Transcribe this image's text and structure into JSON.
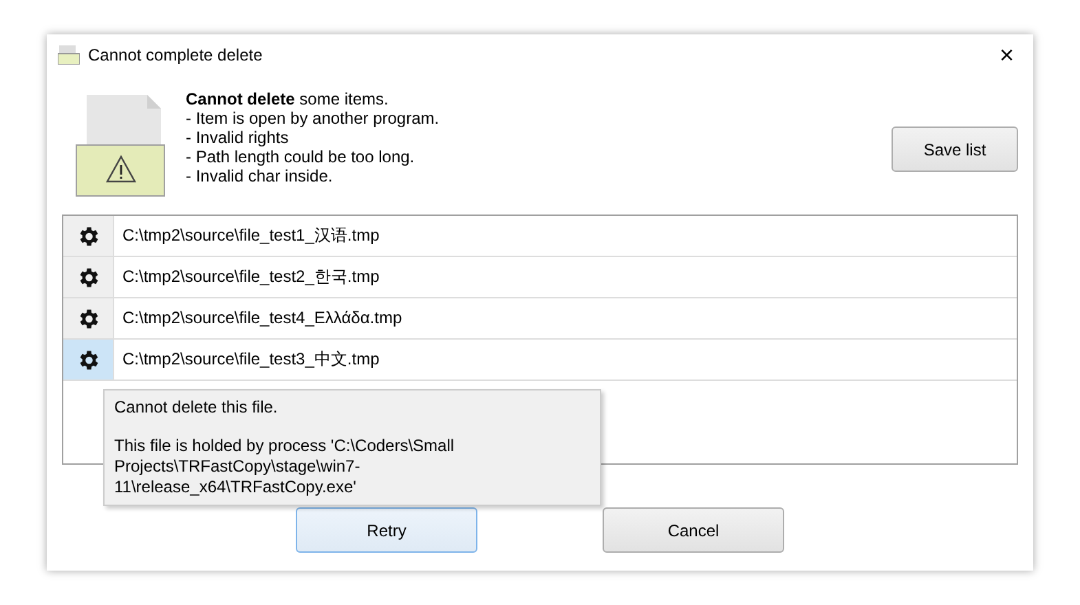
{
  "window": {
    "title": "Cannot complete delete",
    "close": "×"
  },
  "message": {
    "heading": "**Cannot delete** some items.",
    "lines": [
      "- Item is open by another program.",
      "- Invalid rights",
      "- Path length could be too long.",
      "- Invalid char inside."
    ]
  },
  "save_button": "Save list",
  "files": [
    {
      "path": "C:\\tmp2\\source\\file_test1_汉语.tmp",
      "selected": false
    },
    {
      "path": "C:\\tmp2\\source\\file_test2_한국.tmp",
      "selected": false
    },
    {
      "path": "C:\\tmp2\\source\\file_test4_Ελλάδα.tmp",
      "selected": false
    },
    {
      "path": "C:\\tmp2\\source\\file_test3_中文.tmp",
      "selected": true
    }
  ],
  "tooltip": {
    "title": "Cannot delete this file.",
    "detail": "This file is holded by process 'C:\\Coders\\Small Projects\\TRFastCopy\\stage\\win7-11\\release_x64\\TRFastCopy.exe'"
  },
  "buttons": [
    {
      "label": "Retry",
      "focused": true
    },
    {
      "label": "Cancel",
      "focused": false
    }
  ]
}
